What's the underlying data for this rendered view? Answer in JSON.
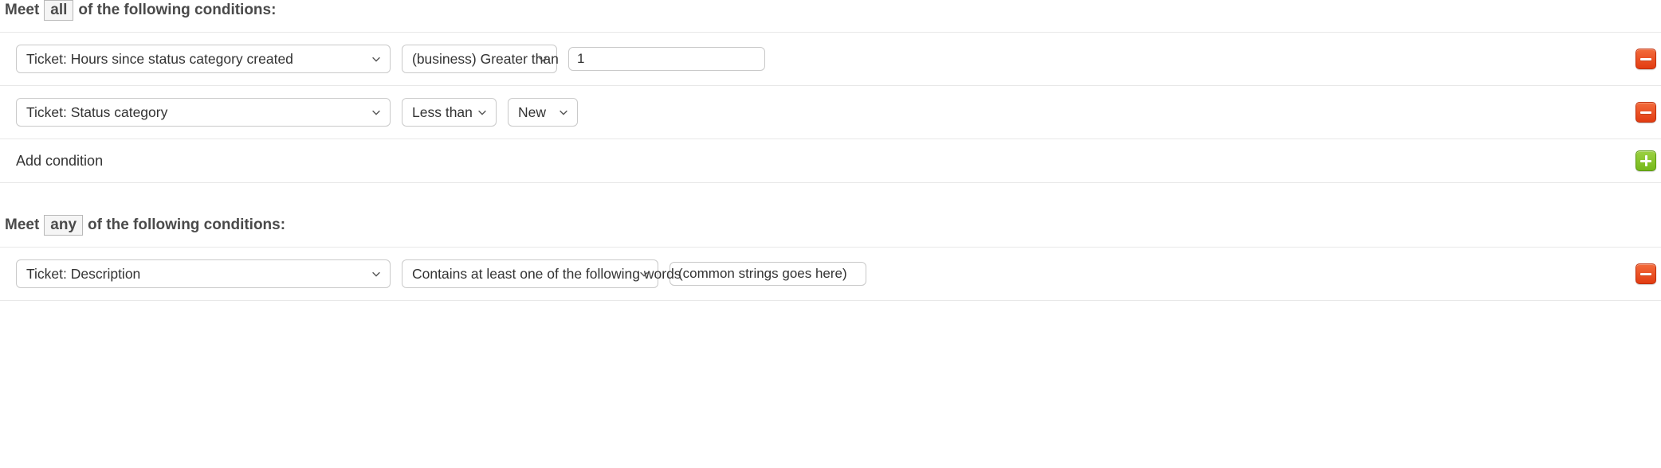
{
  "sections": [
    {
      "key": "all",
      "heading_prefix": "Meet",
      "heading_badge": "all",
      "heading_suffix": "of the following conditions:",
      "rows": [
        {
          "field": "Ticket: Hours since status category created",
          "operator": "(business) Greater than",
          "operator_size": "lg",
          "value": "1",
          "value_kind": "text"
        },
        {
          "field": "Ticket: Status category",
          "operator": "Less than",
          "operator_size": "sm",
          "value": "New",
          "value_kind": "select-sm"
        }
      ],
      "add_label": "Add condition"
    },
    {
      "key": "any",
      "heading_prefix": "Meet",
      "heading_badge": "any",
      "heading_suffix": "of the following conditions:",
      "rows": [
        {
          "field": "Ticket: Description",
          "operator": "Contains at least one of the following words",
          "operator_size": "xl",
          "value": "(common strings goes here)",
          "value_kind": "text"
        }
      ]
    }
  ]
}
